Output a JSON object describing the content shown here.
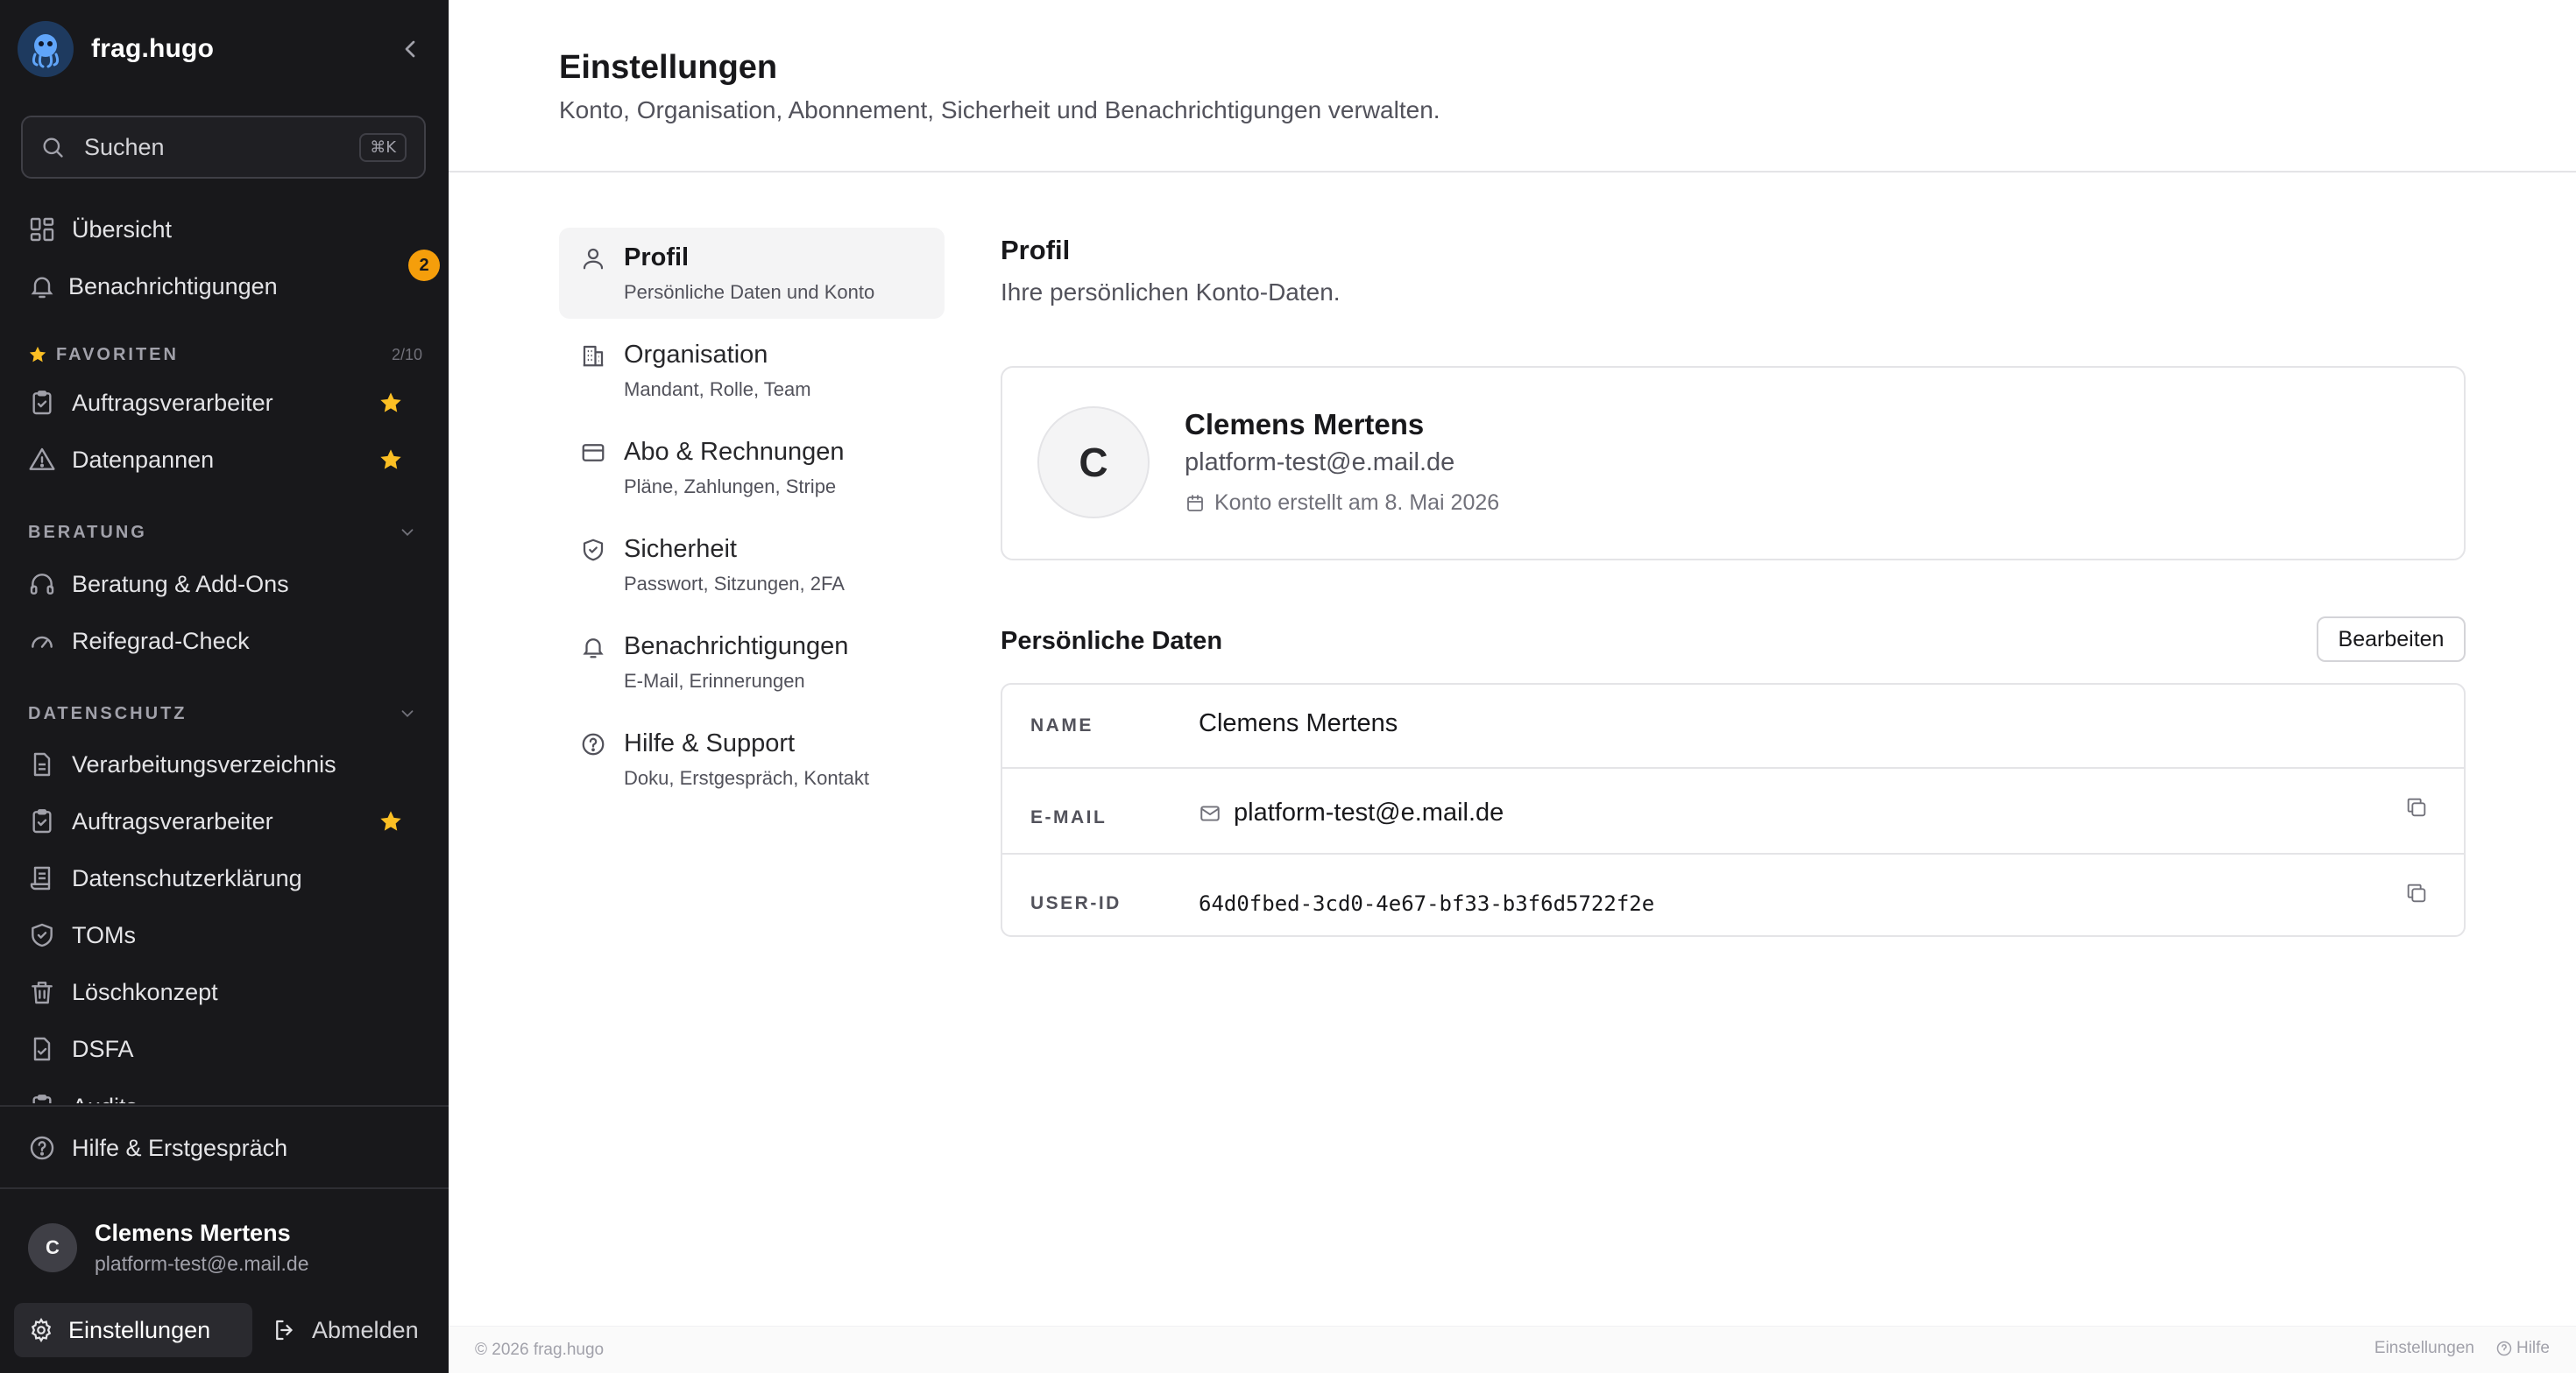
{
  "brand": {
    "name": "frag.hugo"
  },
  "search": {
    "label": "Suchen",
    "shortcut": "⌘K"
  },
  "nav": {
    "overview": "Übersicht",
    "notifications": "Benachrichtigungen",
    "notifications_badge": "2",
    "favorites_head": "FAVORITEN",
    "favorites_count": "2/10",
    "fav_processors": "Auftragsverarbeiter",
    "fav_breaches": "Datenpannen",
    "consulting_head": "BERATUNG",
    "consulting_addons": "Beratung & Add-Ons",
    "maturity_check": "Reifegrad-Check",
    "privacy_head": "DATENSCHUTZ",
    "processing_register": "Verarbeitungsverzeichnis",
    "processors": "Auftragsverarbeiter",
    "privacy_policy": "Datenschutzerklärung",
    "toms": "TOMs",
    "deletion_concept": "Löschkonzept",
    "dpia": "DSFA",
    "audits": "Audits",
    "help": "Hilfe & Erstgespräch"
  },
  "user": {
    "initial": "C",
    "name": "Clemens Mertens",
    "email": "platform-test@e.mail.de"
  },
  "bottom": {
    "settings": "Einstellungen",
    "logout": "Abmelden"
  },
  "header": {
    "title": "Einstellungen",
    "subtitle": "Konto, Organisation, Abonnement, Sicherheit und Benachrichtigungen verwalten."
  },
  "settings_nav": [
    {
      "title": "Profil",
      "desc": "Persönliche Daten und Konto"
    },
    {
      "title": "Organisation",
      "desc": "Mandant, Rolle, Team"
    },
    {
      "title": "Abo & Rechnungen",
      "desc": "Pläne, Zahlungen, Stripe"
    },
    {
      "title": "Sicherheit",
      "desc": "Passwort, Sitzungen, 2FA"
    },
    {
      "title": "Benachrichtigungen",
      "desc": "E-Mail, Erinnerungen"
    },
    {
      "title": "Hilfe & Support",
      "desc": "Doku, Erstgespräch, Kontakt"
    }
  ],
  "profile": {
    "title": "Profil",
    "subtitle": "Ihre persönlichen Konto-Daten.",
    "initial": "C",
    "name": "Clemens Mertens",
    "email": "platform-test@e.mail.de",
    "created": "Konto erstellt am 8. Mai 2026"
  },
  "personal": {
    "title": "Persönliche Daten",
    "edit": "Bearbeiten",
    "rows": [
      {
        "key": "NAME",
        "value": "Clemens Mertens"
      },
      {
        "key": "E-MAIL",
        "value": "platform-test@e.mail.de"
      },
      {
        "key": "USER-ID",
        "value": "64d0fbed-3cd0-4e67-bf33-b3f6d5722f2e"
      }
    ]
  },
  "footer": {
    "copyright": "© 2026 frag.hugo",
    "link_settings": "Einstellungen",
    "link_help": "Hilfe"
  },
  "colors": {
    "sidebar_bg": "#18181b",
    "accent_star": "#fbbf24",
    "badge": "#f59e0b"
  }
}
